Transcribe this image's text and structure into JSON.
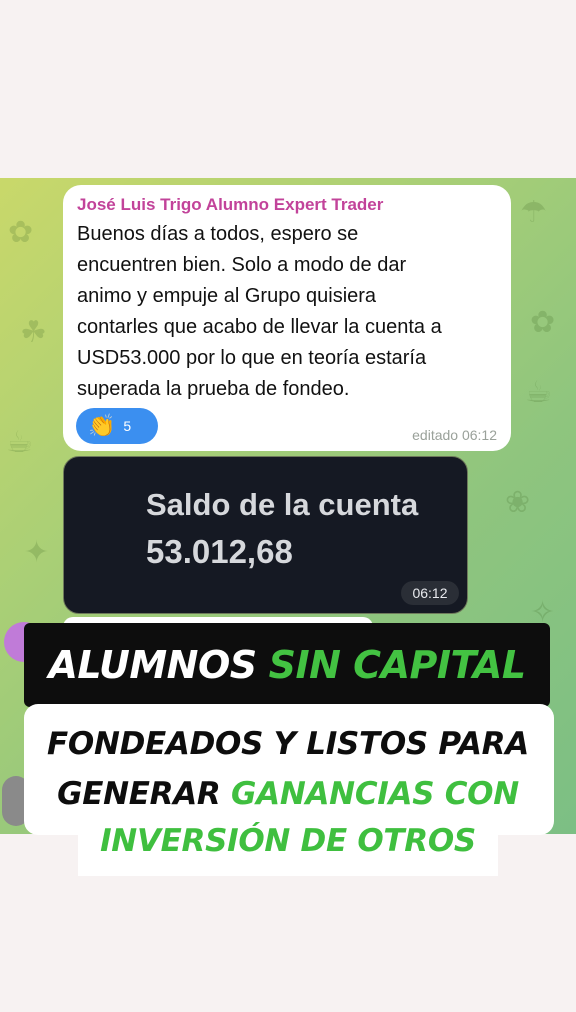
{
  "message": {
    "sender": "José Luis Trigo Alumno Expert Trader",
    "lines": [
      "Buenos días a todos, espero se",
      "encuentren bien. Solo a modo de dar",
      "animo y empuje al Grupo quisiera",
      "contarles que acabo de llevar la cuenta a",
      "USD53.000 por lo que en teoría estaría",
      "superada la prueba de fondeo."
    ],
    "reaction_emoji": "👏",
    "reaction_count": "5",
    "edited_label": "editado 06:12"
  },
  "image_message": {
    "label": "Saldo de la cuenta",
    "value": "53.012,68",
    "time": "06:12"
  },
  "banner": {
    "headline_white": "ALUMNOS",
    "headline_green": "SIN CAPITAL",
    "line1": "FONDEADOS Y LISTOS PARA",
    "line2_black": "GENERAR",
    "line2_green": "GANANCIAS CON",
    "line3_green": "INVERSIÓN DE OTROS"
  },
  "colors": {
    "sender": "#c2439a",
    "reaction_bg": "#3b8ff0",
    "accent_green": "#43c242",
    "chat_bg": "#a9cf76"
  }
}
